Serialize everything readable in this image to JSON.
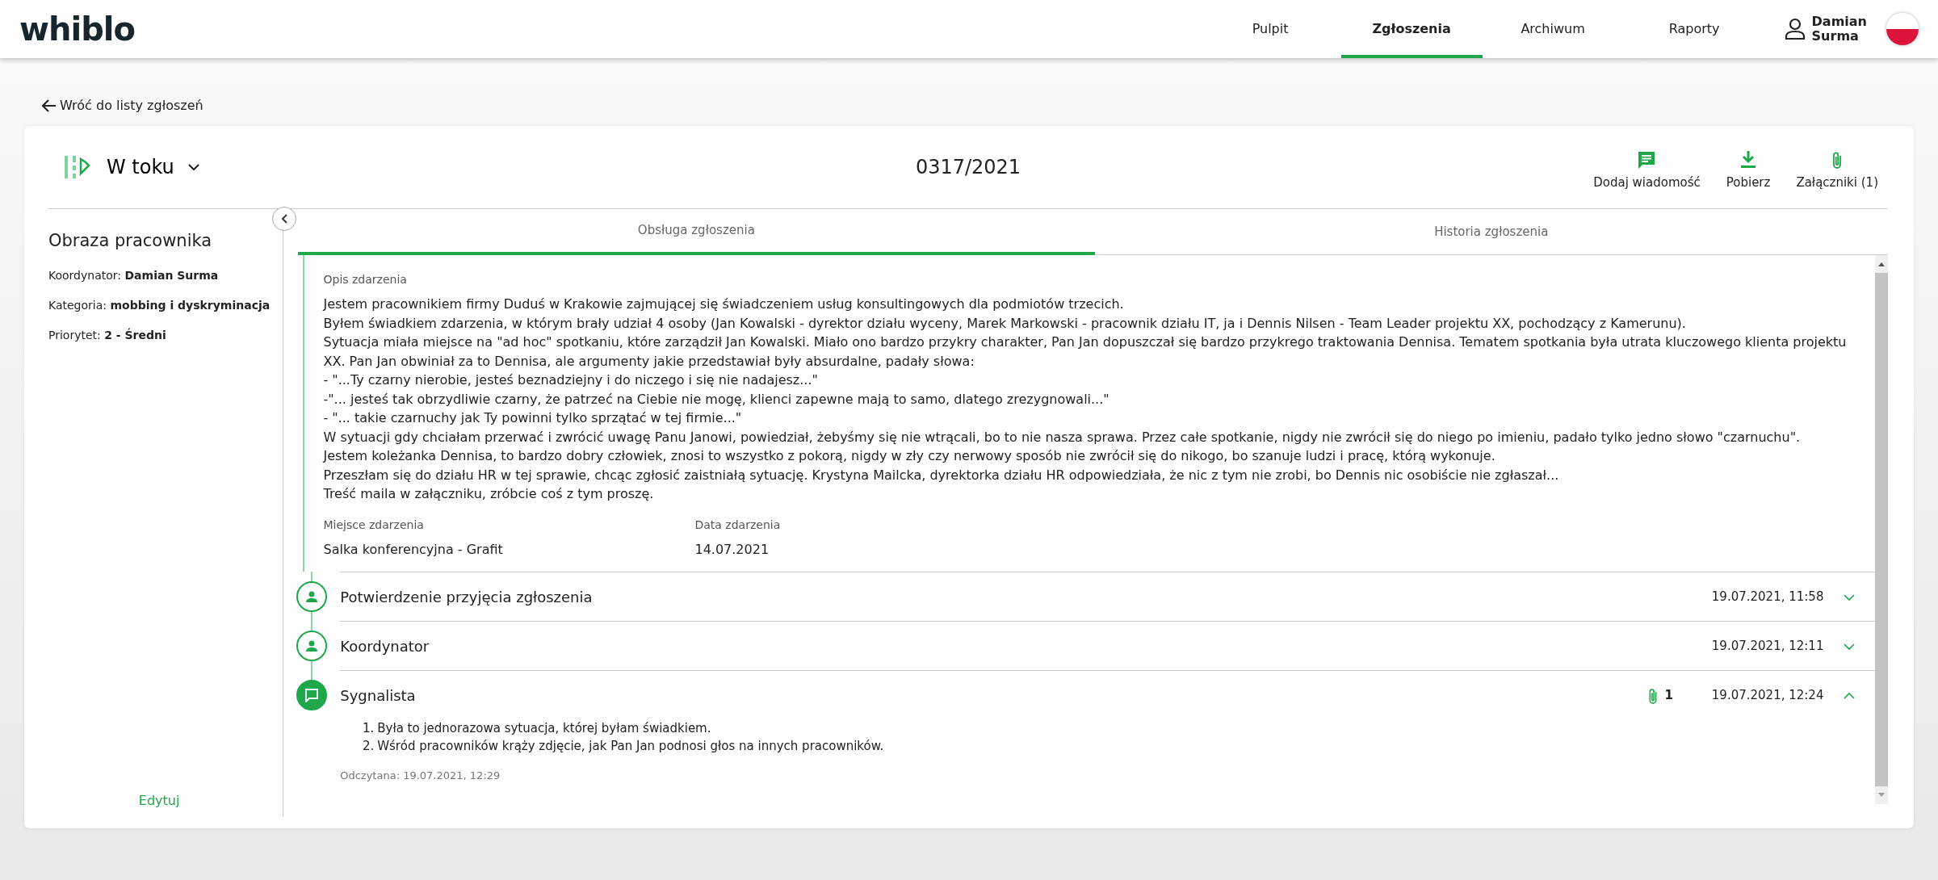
{
  "header": {
    "logo": "whiblo",
    "nav": [
      {
        "label": "Pulpit",
        "selected": false
      },
      {
        "label": "Zgłoszenia",
        "selected": true
      },
      {
        "label": "Archiwum",
        "selected": false
      },
      {
        "label": "Raporty",
        "selected": false
      }
    ],
    "user": [
      "Damian",
      "Surma"
    ]
  },
  "back_link": "Wróć do listy zgłoszeń",
  "case": {
    "status": "W toku",
    "number": "0317/2021",
    "actions": [
      {
        "kind": "message",
        "label": "Dodaj wiadomość"
      },
      {
        "kind": "download",
        "label": "Pobierz"
      },
      {
        "kind": "attachment",
        "label": "Załączniki (1)"
      }
    ]
  },
  "sidebar": {
    "title": "Obraza pracownika",
    "fields": [
      {
        "label": "Koordynator:",
        "value": "Damian Surma"
      },
      {
        "label": "Kategoria:",
        "value": "mobbing i dyskryminacja"
      },
      {
        "label": "Priorytet:",
        "value": "2 - Średni"
      }
    ],
    "edit": "Edytuj"
  },
  "tabs": [
    {
      "label": "Obsługa zgłoszenia",
      "selected": true
    },
    {
      "label": "Historia zgłoszenia",
      "selected": false
    }
  ],
  "report": {
    "description_label": "Opis zdarzenia",
    "description": [
      "Jestem pracownikiem firmy Duduś w Krakowie zajmującej się świadczeniem usług konsultingowych dla podmiotów trzecich.",
      "Byłem świadkiem zdarzenia, w którym brały udział 4 osoby (Jan Kowalski - dyrektor działu wyceny, Marek Markowski - pracownik działu IT, ja i Dennis Nilsen - Team Leader projektu XX, pochodzący z Kamerunu).",
      "Sytuacja miała miejsce na \"ad hoc\" spotkaniu, które zarządził Jan Kowalski. Miało ono bardzo przykry charakter, Pan Jan dopuszczał się bardzo przykrego traktowania Dennisa. Tematem spotkania była utrata kluczowego klienta projektu XX. Pan Jan obwiniał za to Dennisa, ale argumenty jakie przedstawiał były absurdalne, padały słowa:",
      "- \"...Ty czarny nierobie, jesteś beznadziejny i do niczego i się nie nadajesz...\"",
      "-\"... jesteś tak obrzydliwie czarny, że patrzeć na Ciebie nie mogę, klienci zapewne mają to samo, dlatego zrezygnowali...\"",
      "- \"... takie czarnuchy jak Ty powinni tylko sprzątać w tej firmie...\"",
      "W sytuacji gdy chciałam przerwać i zwrócić uwagę Panu Janowi, powiedział, żebyśmy się nie wtrącali, bo to nie nasza sprawa. Przez całe spotkanie, nigdy nie zwrócił się do niego po imieniu, padało tylko jedno słowo \"czarnuchu\".",
      "Jestem koleżanka Dennisa, to bardzo dobry człowiek, znosi to wszystko z pokorą, nigdy w zły czy nerwowy sposób nie zwrócił się do nikogo, bo szanuje ludzi i pracę, którą wykonuje.",
      "Przeszłam się do działu HR w tej sprawie, chcąc zgłosić zaistniałą sytuację. Krystyna Mailcka, dyrektorka działu HR odpowiedziała, że nic z tym nie zrobi, bo Dennis nic osobiście nie zgłaszał...",
      "Treść maila w załączniku, zróbcie coś z tym proszę."
    ],
    "details": [
      {
        "label": "Miejsce zdarzenia",
        "value": "Salka konferencyjna - Grafit"
      },
      {
        "label": "Data zdarzenia",
        "value": "14.07.2021"
      }
    ]
  },
  "timeline": [
    {
      "kind": "person",
      "title": "Potwierdzenie przyjęcia zgłoszenia",
      "date": "19.07.2021, 11:58",
      "expanded": false
    },
    {
      "kind": "person",
      "title": "Koordynator",
      "date": "19.07.2021, 12:11",
      "expanded": false
    },
    {
      "kind": "message",
      "title": "Sygnalista",
      "date": "19.07.2021, 12:24",
      "expanded": true,
      "attachments": "1",
      "items": [
        {
          "marker": "1.",
          "text": "Była to jednorazowa sytuacja, której byłam świadkiem."
        },
        {
          "marker": "2.",
          "text": "Wśród pracowników krąży zdjęcie, jak Pan Jan podnosi głos na innych pracowników."
        }
      ],
      "read": "Odczytana: 19.07.2021, 12:29"
    }
  ]
}
